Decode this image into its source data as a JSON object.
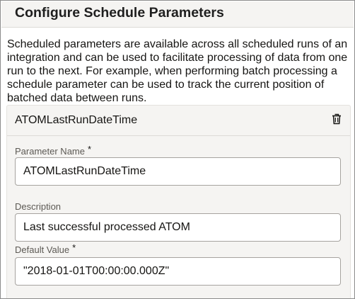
{
  "dialog": {
    "title": "Configure Schedule Parameters",
    "intro": "Scheduled parameters are available across all scheduled runs of an integration and can be used to facilitate processing of data from one run to the next. For example, when performing batch processing a schedule parameter can be used to track the current position of batched data between runs."
  },
  "parameter": {
    "header_title": "ATOMLastRunDateTime",
    "delete_icon": "trash-icon",
    "fields": {
      "name": {
        "label": "Parameter Name",
        "required_marker": "*",
        "value": "ATOMLastRunDateTime"
      },
      "description": {
        "label": "Description",
        "value": "Last successful processed ATOM"
      },
      "default_value": {
        "label": "Default Value",
        "required_marker": "*",
        "value": "\"2018-01-01T00:00:00.000Z\""
      }
    }
  },
  "colors": {
    "header_bg": "#f5f4f2",
    "card_bg": "#f5f4f2",
    "border": "#8c8c8c",
    "text": "#161513",
    "label": "#5c5954"
  }
}
